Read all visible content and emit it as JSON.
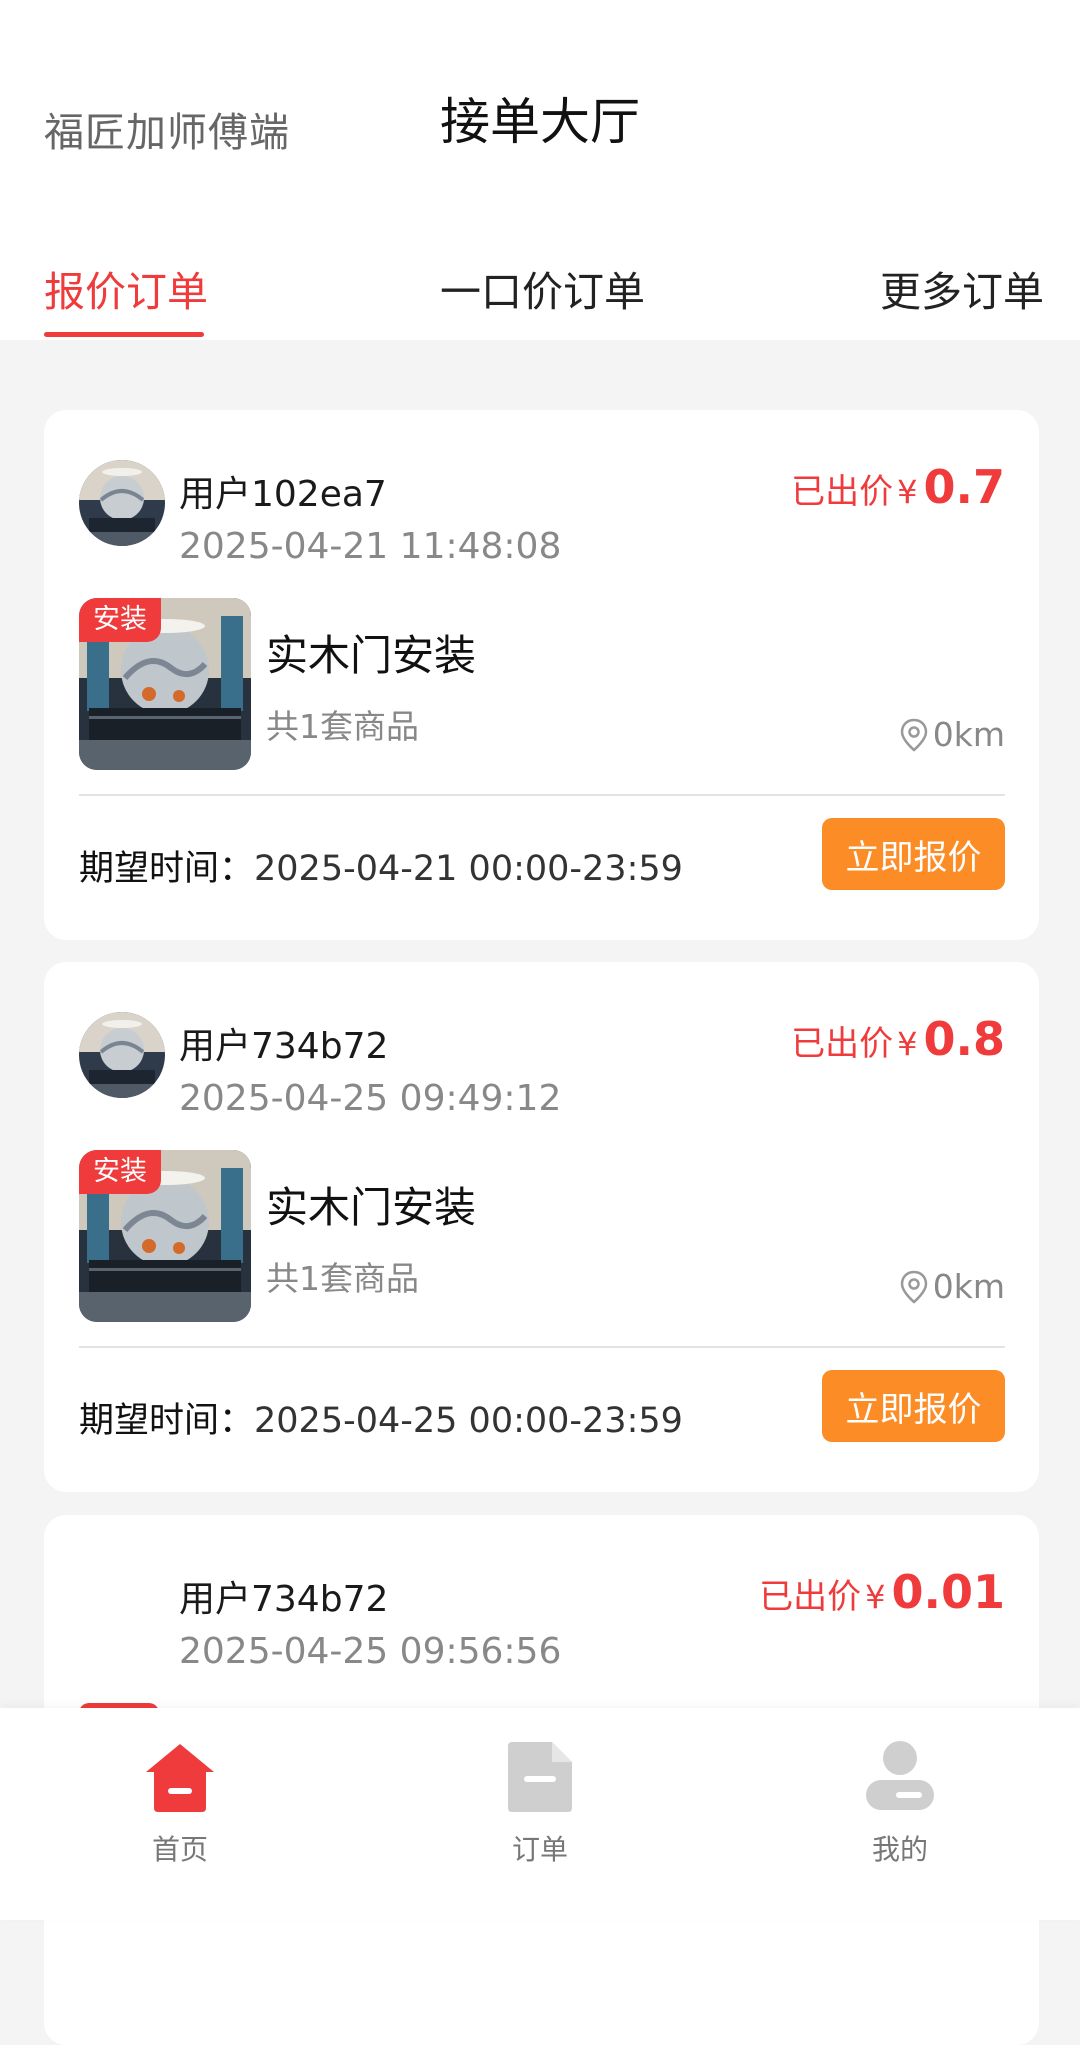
{
  "header": {
    "app_name": "福匠加师傅端",
    "title": "接单大厅"
  },
  "tabs": [
    {
      "label": "报价订单",
      "active": true
    },
    {
      "label": "一口价订单",
      "active": false
    },
    {
      "label": "更多订单",
      "active": false
    }
  ],
  "colors": {
    "accent": "#ef3b3b",
    "button": "#fb8c26"
  },
  "orders": [
    {
      "user": "用户102ea7",
      "time": "2025-04-21 11:48:08",
      "price_label": "已出价",
      "currency": "¥",
      "price": "0.7",
      "tag": "安装",
      "service": "实木门安装",
      "goods": "共1套商品",
      "distance": "0km",
      "expect_label": "期望时间：",
      "expect_value": "2025-04-21 00:00-23:59",
      "button": "立即报价"
    },
    {
      "user": "用户734b72",
      "time": "2025-04-25 09:49:12",
      "price_label": "已出价",
      "currency": "¥",
      "price": "0.8",
      "tag": "安装",
      "service": "实木门安装",
      "goods": "共1套商品",
      "distance": "0km",
      "expect_label": "期望时间：",
      "expect_value": "2025-04-25 00:00-23:59",
      "button": "立即报价"
    },
    {
      "user": "用户734b72",
      "time": "2025-04-25 09:56:56",
      "price_label": "已出价",
      "currency": "¥",
      "price": "0.01"
    }
  ],
  "bottom_nav": [
    {
      "label": "首页",
      "icon": "home-icon",
      "active": true
    },
    {
      "label": "订单",
      "icon": "document-icon",
      "active": false
    },
    {
      "label": "我的",
      "icon": "user-icon",
      "active": false
    }
  ]
}
